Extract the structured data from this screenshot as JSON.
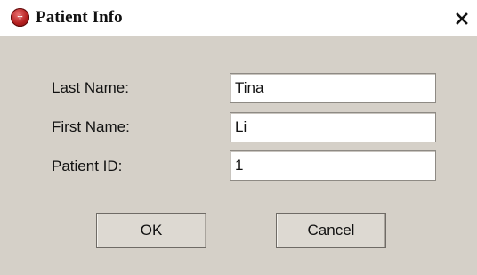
{
  "window": {
    "title": "Patient Info",
    "icon": "app-logo-icon",
    "close_icon": "close-icon"
  },
  "form": {
    "last_name": {
      "label": "Last Name:",
      "value": "Tina"
    },
    "first_name": {
      "label": "First Name:",
      "value": "Li"
    },
    "patient_id": {
      "label": "Patient ID:",
      "value": "1"
    }
  },
  "buttons": {
    "ok_label": "OK",
    "cancel_label": "Cancel"
  },
  "colors": {
    "dialog_bg": "#d5d0c8",
    "title_bg": "#ffffff",
    "icon_red": "#b31e1e"
  }
}
